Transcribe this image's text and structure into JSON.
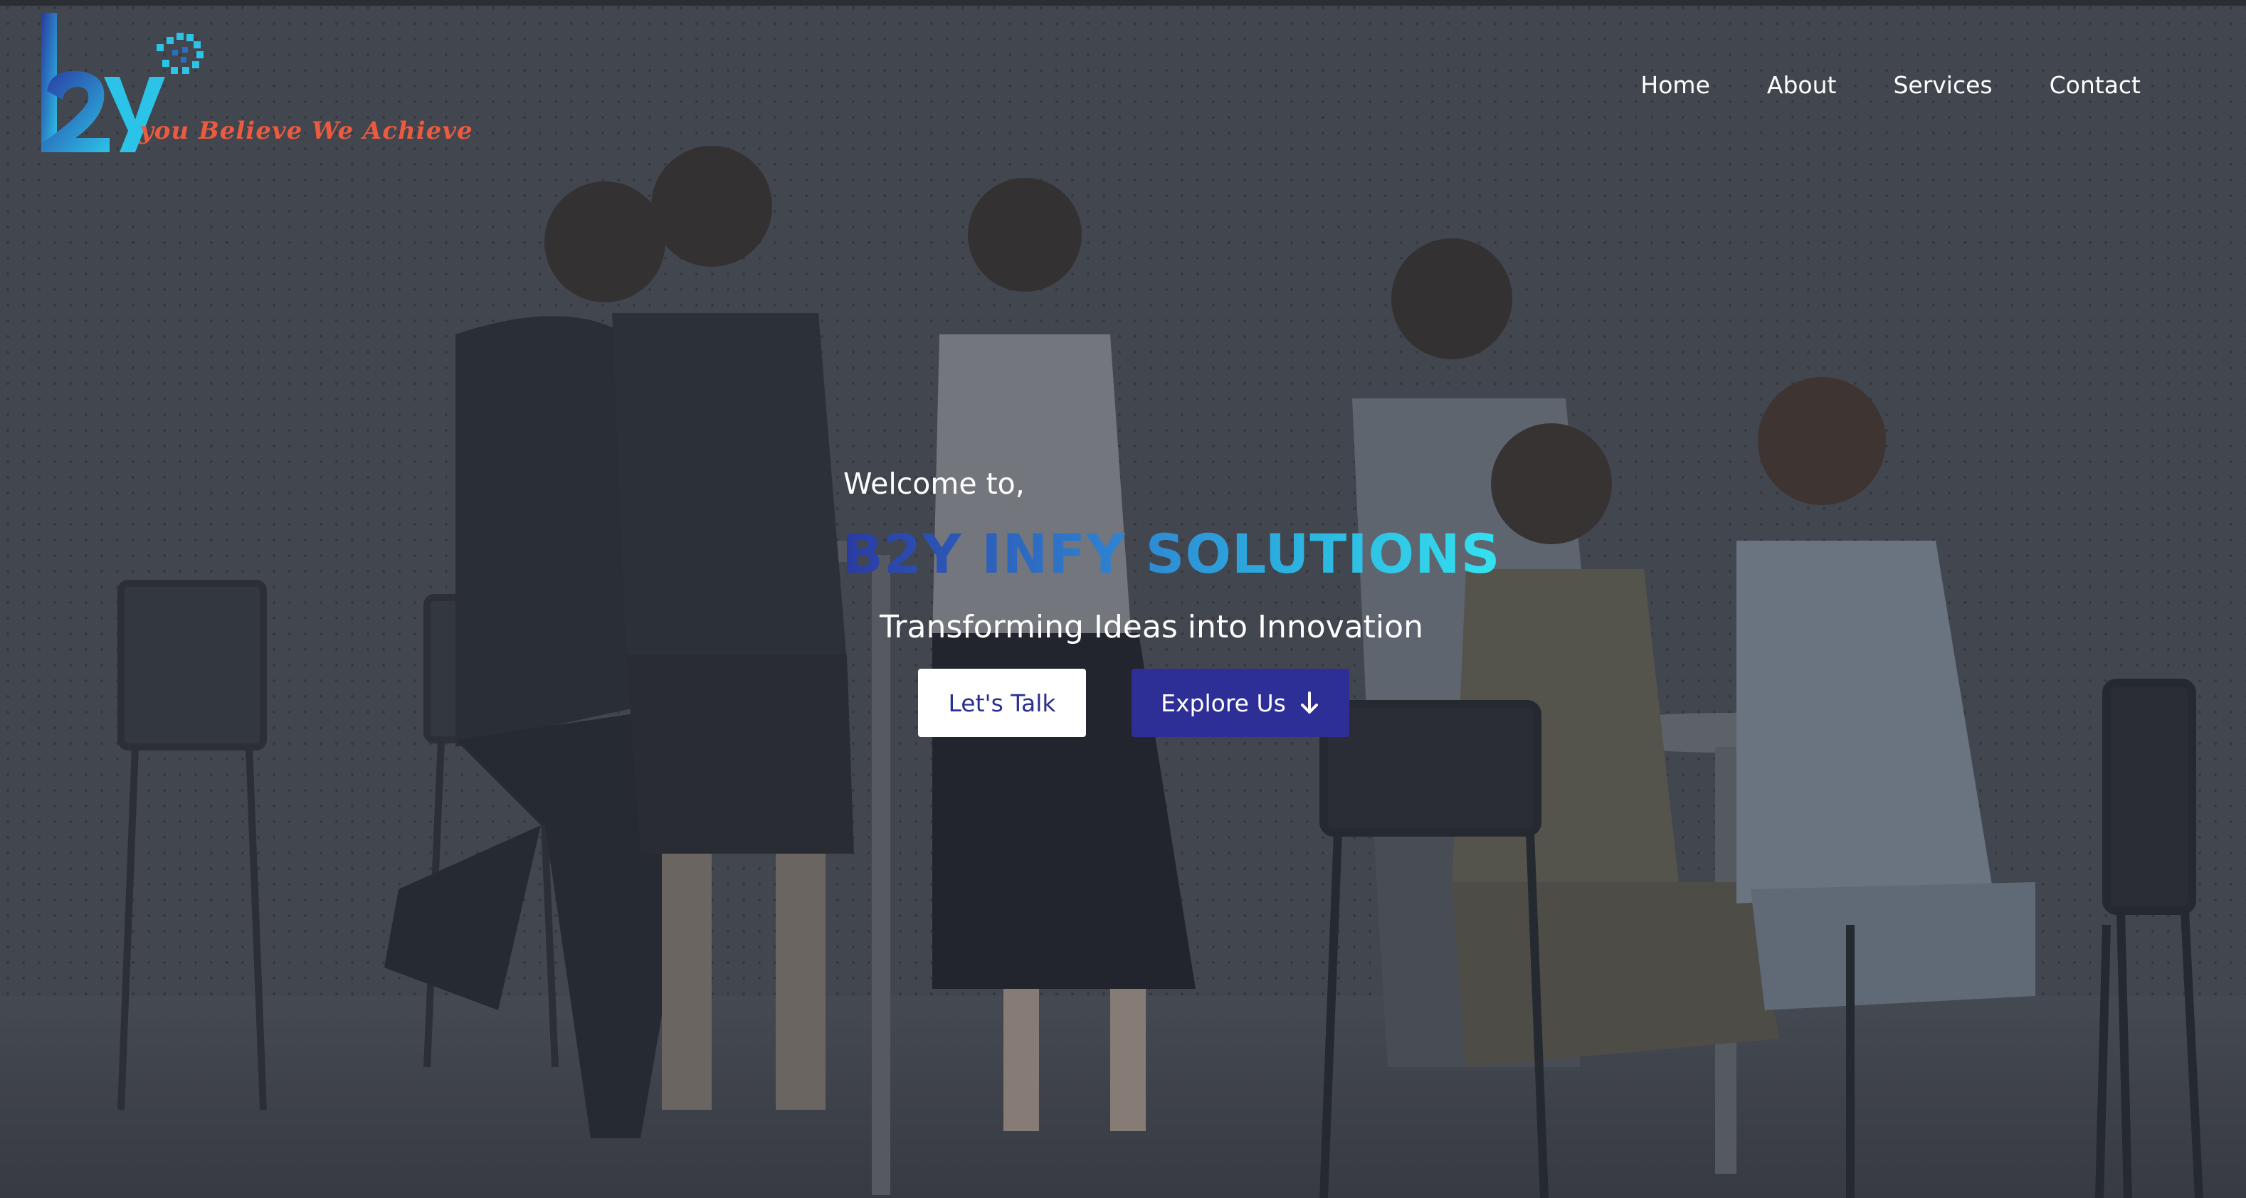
{
  "brand": {
    "logo_text": "b2y",
    "tagline": "you Believe We Achieve"
  },
  "nav": {
    "items": [
      "Home",
      "About",
      "Services",
      "Contact"
    ]
  },
  "hero": {
    "welcome": "Welcome to,",
    "company": "B2Y INFY SOLUTIONS",
    "subtitle": "Transforming Ideas into Innovation",
    "primary_button": "Let's Talk",
    "secondary_button": "Explore Us",
    "secondary_button_icon": "arrow-down-icon"
  },
  "colors": {
    "tagline": "#ec5a3f",
    "button_primary_text": "#2b2f8f",
    "button_secondary_bg": "#2d2f96",
    "brand_gradient": [
      "#2a3aa0",
      "#34e2f0"
    ]
  }
}
